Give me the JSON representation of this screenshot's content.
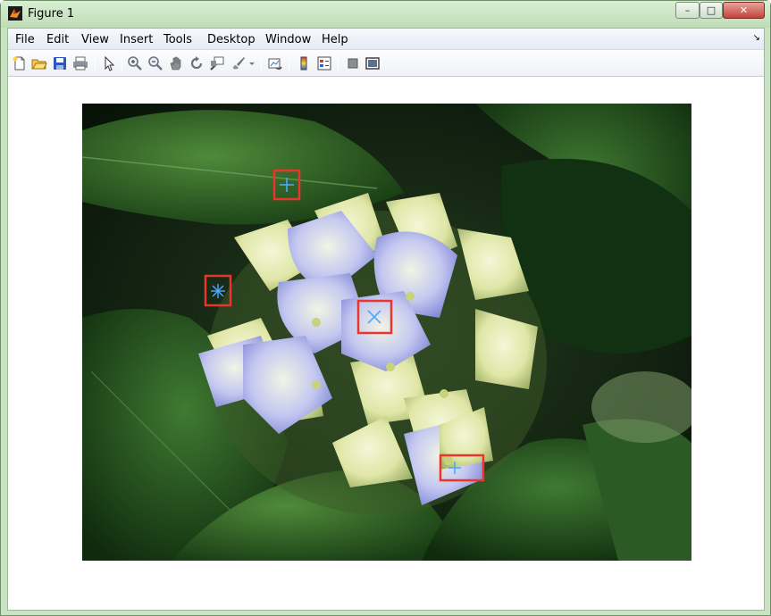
{
  "window": {
    "title": "Figure 1",
    "controls": {
      "minimize": "–",
      "maximize": "□",
      "close": "✕"
    }
  },
  "menubar": {
    "items": [
      "File",
      "Edit",
      "View",
      "Insert",
      "Tools",
      "Desktop",
      "Window",
      "Help"
    ],
    "corner_glyph": "↘"
  },
  "toolbar": {
    "icons": [
      "new-figure-icon",
      "open-file-icon",
      "save-icon",
      "print-icon",
      "edit-plot-icon",
      "zoom-in-icon",
      "zoom-out-icon",
      "pan-icon",
      "rotate-3d-icon",
      "data-cursor-icon",
      "brush-icon",
      "link-plot-icon",
      "insert-colorbar-icon",
      "insert-legend-icon",
      "hide-plot-tools-icon",
      "show-plot-tools-icon"
    ]
  },
  "figure": {
    "image": "hydrangea-flower-photo",
    "markers": [
      {
        "name": "marker-top",
        "symbol": "+",
        "color": "#4aa8ff"
      },
      {
        "name": "marker-left",
        "symbol": "*",
        "color": "#4aa8ff"
      },
      {
        "name": "marker-center",
        "symbol": "x",
        "color": "#4aa8ff"
      },
      {
        "name": "marker-bottom",
        "symbol": "+",
        "color": "#4aa8ff"
      }
    ],
    "box_color": "#e8362f"
  },
  "colors": {
    "frame": "#c9e3c3",
    "close_button": "#c1453a",
    "menubar": "#e4ebf5"
  }
}
